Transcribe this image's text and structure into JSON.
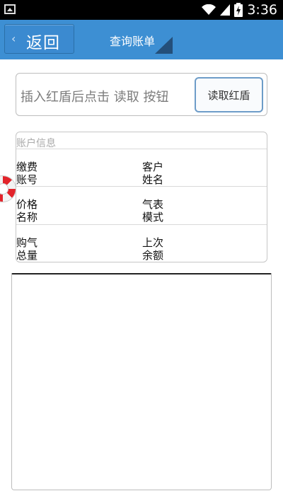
{
  "status_bar": {
    "time": "3:36",
    "icons": [
      "image-icon",
      "wifi-icon",
      "signal-icon",
      "battery-charging-icon"
    ]
  },
  "navbar": {
    "back_label": "返回",
    "title": "查询账单",
    "color": "#3d8fd3"
  },
  "read_section": {
    "hint": "插入红盾后点击 读取 按钮",
    "button_label": "读取红盾"
  },
  "account_info": {
    "section_title": "账户信息",
    "fields": [
      {
        "label": "缴费账号",
        "value": ""
      },
      {
        "label": "客户姓名",
        "value": ""
      },
      {
        "label": "价格名称",
        "value": ""
      },
      {
        "label": "气表模式",
        "value": ""
      },
      {
        "label": "购气总量",
        "value": ""
      },
      {
        "label": "上次余额",
        "value": ""
      }
    ]
  },
  "output": {
    "text": ""
  },
  "colors": {
    "accent": "#3d8fd3",
    "buoy": "#e2232a"
  }
}
